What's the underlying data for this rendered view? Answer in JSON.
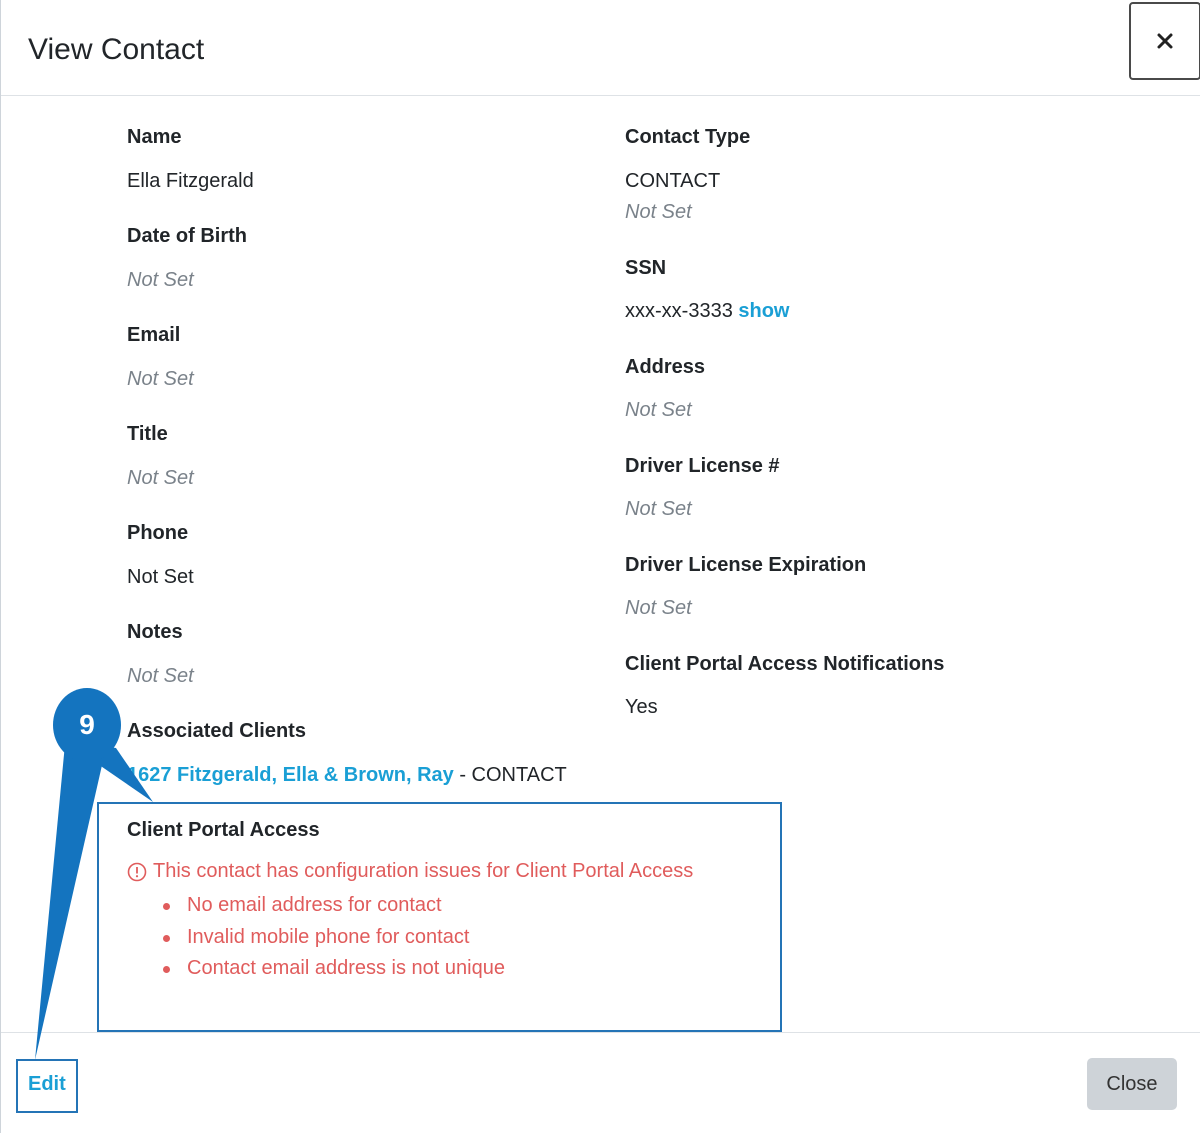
{
  "header": {
    "title": "View Contact",
    "close_icon": "close-icon"
  },
  "left_fields": [
    {
      "label": "Name",
      "value": "Ella Fitzgerald",
      "not_set": false
    },
    {
      "label": "Date of Birth",
      "value": "Not Set",
      "not_set": true
    },
    {
      "label": "Email",
      "value": "Not Set",
      "not_set": true
    },
    {
      "label": "Title",
      "value": "Not Set",
      "not_set": true
    },
    {
      "label": "Phone",
      "value": "Not Set",
      "not_set": false
    },
    {
      "label": "Notes",
      "value": "Not Set",
      "not_set": true
    }
  ],
  "right_fields": {
    "contact_type": {
      "label": "Contact Type",
      "value": "CONTACT",
      "subvalue": "Not Set"
    },
    "ssn": {
      "label": "SSN",
      "value": "xxx-xx-3333",
      "show_link": "show"
    },
    "address": {
      "label": "Address",
      "value": "Not Set"
    },
    "driver_license": {
      "label": "Driver License #",
      "value": "Not Set"
    },
    "driver_license_expiration": {
      "label": "Driver License Expiration",
      "value": "Not Set"
    },
    "portal_notifications": {
      "label": "Client Portal Access Notifications",
      "value": "Yes"
    }
  },
  "associated_clients": {
    "label": "Associated Clients",
    "link": "1627 Fitzgerald, Ella & Brown, Ray",
    "suffix": " - CONTACT"
  },
  "client_portal_access": {
    "label": "Client Portal Access",
    "warning": "This contact has configuration issues for Client Portal Access",
    "issues": [
      "No email address for contact",
      "Invalid mobile phone for contact",
      "Contact email address is not unique"
    ]
  },
  "footer": {
    "edit_label": "Edit",
    "close_label": "Close"
  },
  "callout": {
    "number": "9",
    "color": "#1474bf"
  },
  "colors": {
    "link": "#1a9fd5",
    "error": "#e05c5c",
    "highlight": "#2474b6",
    "not_set": "#7a828a"
  }
}
